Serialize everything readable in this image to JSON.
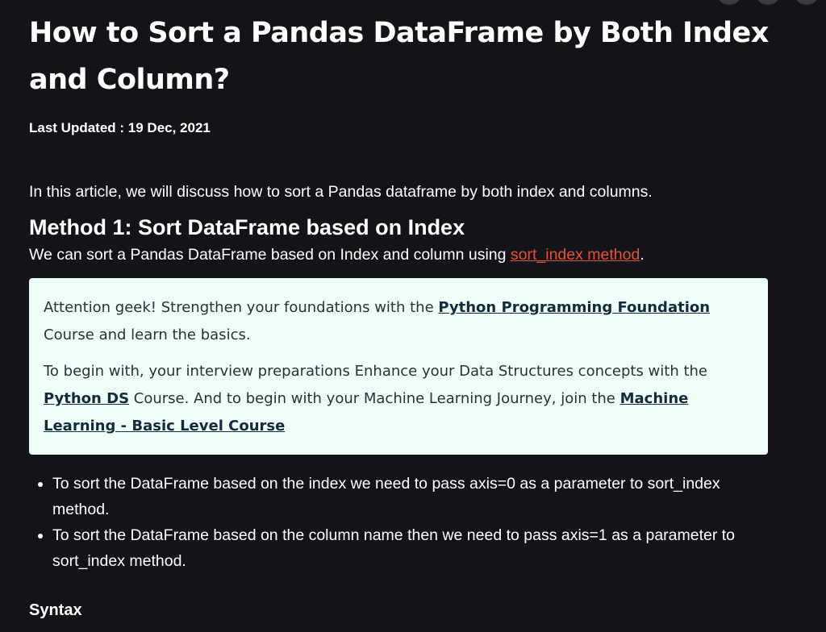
{
  "article": {
    "title": "How to Sort a Pandas DataFrame by Both Index and Column?",
    "last_updated": "Last Updated : 19 Dec, 2021",
    "intro": "In this article, we will discuss how to sort a Pandas dataframe by both index and columns.",
    "method1_heading": "Method 1: Sort DataFrame based on Index",
    "method1_text_before": "We can sort a Pandas DataFrame based on Index and column using ",
    "method1_link": "sort_index method",
    "method1_text_after": ".",
    "bullets": [
      "To sort the DataFrame based on the index we need to pass axis=0 as a parameter to sort_index method.",
      "To sort the DataFrame based on the column name then we need to pass axis=1 as a parameter to sort_index method."
    ],
    "syntax_heading": "Syntax"
  },
  "callout": {
    "p1_before": " Attention geek! Strengthen your foundations with the ",
    "p1_link": "Python Programming Foundation",
    "p1_after": " Course and learn the basics.",
    "p2_before": "To begin with, your interview preparations Enhance your Data Structures concepts with the ",
    "p2_link1": "Python DS",
    "p2_middle": " Course. And to begin with your Machine Learning Journey, join the ",
    "p2_link2": "Machine Learning - Basic Level Course"
  },
  "colors": {
    "background": "#131417",
    "text": "#ffffff",
    "link_accent": "#e2533d",
    "callout_background": "#effff7",
    "callout_text": "#273239"
  }
}
